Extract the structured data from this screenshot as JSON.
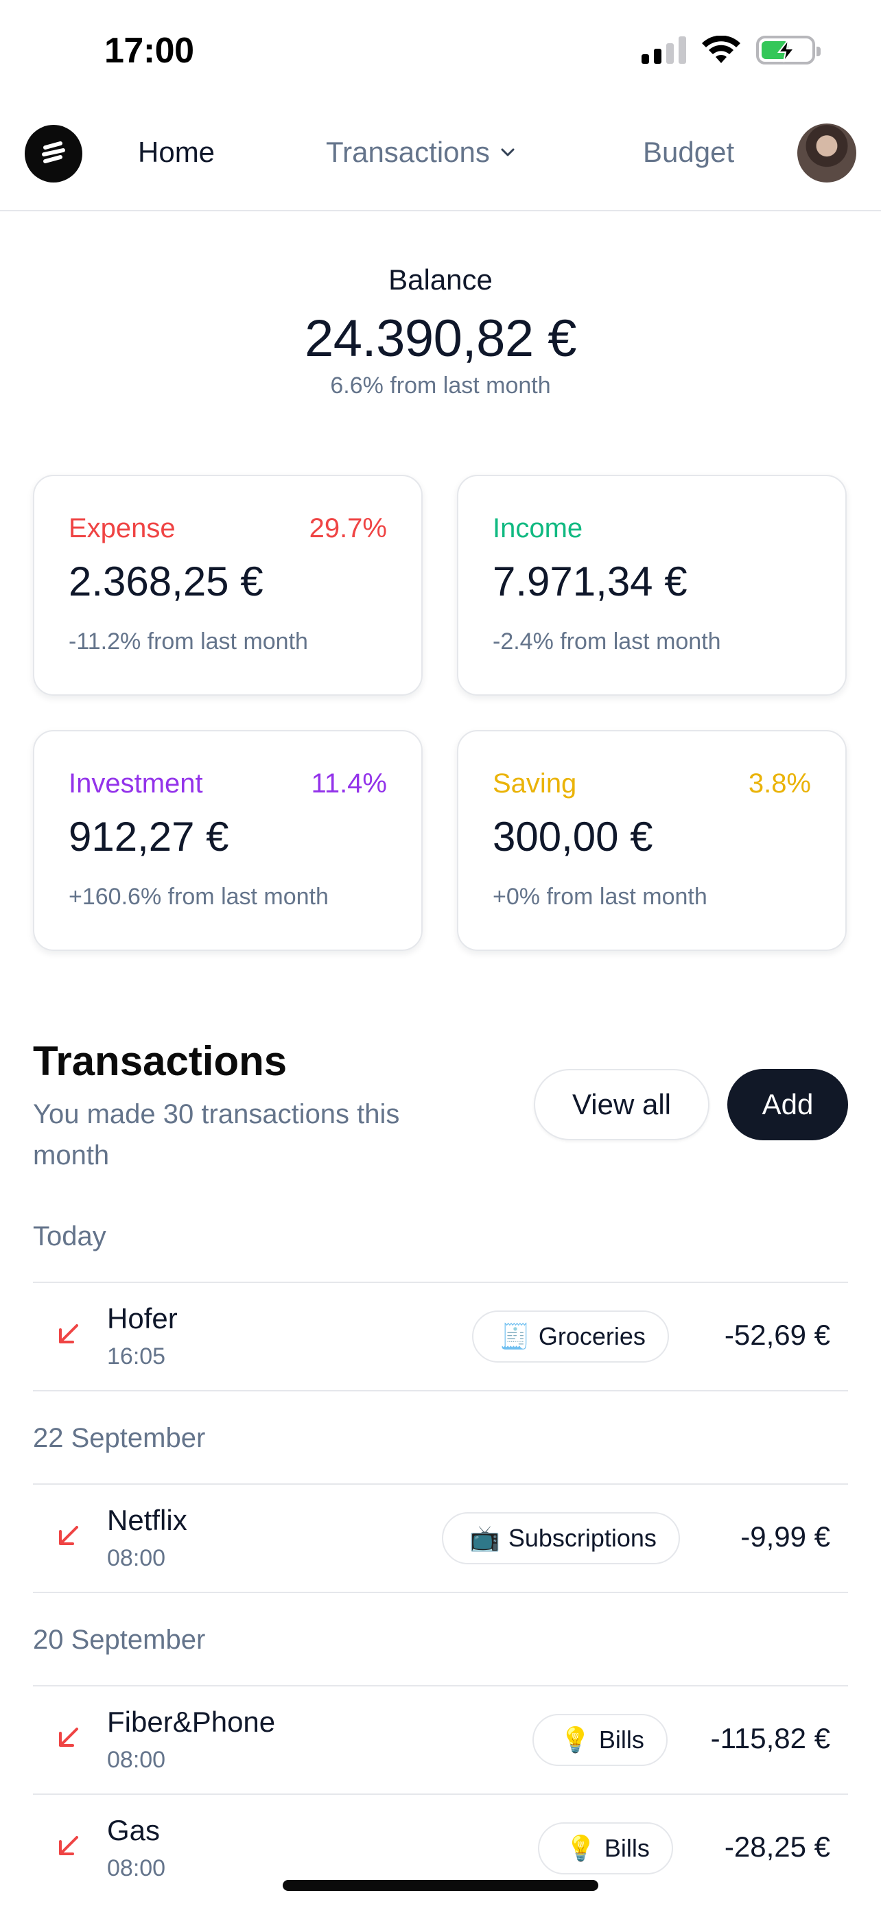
{
  "status_bar": {
    "time": "17:00",
    "signal_icon": "cellular-signal-icon",
    "wifi_icon": "wifi-icon",
    "battery_icon": "battery-charging-icon",
    "battery_color": "#34c759"
  },
  "nav": {
    "logo_icon": "app-logo-icon",
    "home": "Home",
    "transactions": "Transactions",
    "budget": "Budget",
    "avatar_icon": "user-avatar"
  },
  "balance": {
    "label": "Balance",
    "amount": "24.390,82 €",
    "change": "6.6% from last month"
  },
  "cards": {
    "expense": {
      "label": "Expense",
      "percent": "29.7%",
      "amount": "2.368,25 €",
      "change": "-11.2% from last month",
      "color": "#ef4444"
    },
    "income": {
      "label": "Income",
      "amount": "7.971,34 €",
      "change": "-2.4% from last month",
      "color": "#10b981"
    },
    "investment": {
      "label": "Investment",
      "percent": "11.4%",
      "amount": "912,27 €",
      "change": "+160.6% from last month",
      "color": "#9333ea"
    },
    "saving": {
      "label": "Saving",
      "percent": "3.8%",
      "amount": "300,00 €",
      "change": "+0% from last month",
      "color": "#eab308"
    }
  },
  "transactions": {
    "title": "Transactions",
    "subtitle": "You made 30 transactions this month",
    "view_all": "View all",
    "add": "Add",
    "groups": [
      {
        "label": "Today",
        "items": [
          {
            "name": "Hofer",
            "time": "16:05",
            "tag": "Groceries",
            "tag_icon": "🧾",
            "amount": "-52,69 €"
          }
        ]
      },
      {
        "label": "22 September",
        "items": [
          {
            "name": "Netflix",
            "time": "08:00",
            "tag": "Subscriptions",
            "tag_icon": "📺",
            "amount": "-9,99 €"
          }
        ]
      },
      {
        "label": "20 September",
        "items": [
          {
            "name": "Fiber&Phone",
            "time": "08:00",
            "tag": "Bills",
            "tag_icon": "💡",
            "amount": "-115,82 €"
          },
          {
            "name": "Gas",
            "time": "08:00",
            "tag": "Bills",
            "tag_icon": "💡",
            "amount": "-28,25 €"
          }
        ]
      }
    ]
  }
}
